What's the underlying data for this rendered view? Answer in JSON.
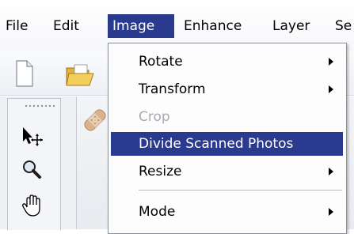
{
  "menubar": {
    "items": [
      "File",
      "Edit",
      "Image",
      "Enhance",
      "Layer",
      "Se"
    ]
  },
  "image_menu": {
    "items": [
      {
        "label": "Rotate",
        "submenu": true,
        "enabled": true
      },
      {
        "label": "Transform",
        "submenu": true,
        "enabled": true
      },
      {
        "label": "Crop",
        "submenu": false,
        "enabled": false
      },
      {
        "label": "Divide Scanned Photos",
        "submenu": false,
        "enabled": true,
        "highlighted": true
      },
      {
        "label": "Resize",
        "submenu": true,
        "enabled": true
      },
      {
        "label": "Mode",
        "submenu": true,
        "enabled": true
      }
    ]
  },
  "colors": {
    "highlight": "#2a3b8f",
    "disabled_text": "#a7a9b0"
  },
  "icons": [
    "new-document-icon",
    "open-folder-icon",
    "move-tool-icon",
    "zoom-tool-icon",
    "hand-tool-icon",
    "healing-brush-icon"
  ]
}
